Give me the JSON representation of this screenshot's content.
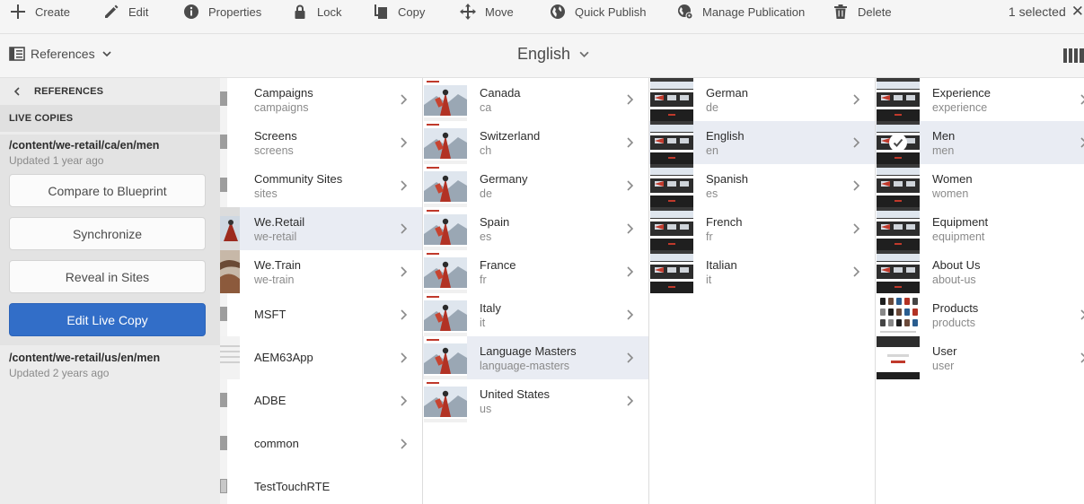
{
  "actionbar": {
    "actions": [
      {
        "label": "Create",
        "icon": "plus-icon"
      },
      {
        "label": "Edit",
        "icon": "pencil-icon"
      },
      {
        "label": "Properties",
        "icon": "info-icon"
      },
      {
        "label": "Lock",
        "icon": "lock-icon"
      },
      {
        "label": "Copy",
        "icon": "copy-icon"
      },
      {
        "label": "Move",
        "icon": "move-icon"
      },
      {
        "label": "Quick Publish",
        "icon": "globe-icon"
      },
      {
        "label": "Manage Publication",
        "icon": "globe-gear-icon"
      },
      {
        "label": "Delete",
        "icon": "trash-icon"
      }
    ],
    "selection_text": "1 selected"
  },
  "titlebar": {
    "rail_label": "References",
    "page_title": "English"
  },
  "rail": {
    "header": "REFERENCES",
    "section": "LIVE COPIES",
    "copies": [
      {
        "path": "/content/we-retail/ca/en/men",
        "updated": "Updated 1 year ago"
      },
      {
        "path": "/content/we-retail/us/en/men",
        "updated": "Updated 2 years ago"
      }
    ],
    "buttons": {
      "compare": "Compare to Blueprint",
      "sync": "Synchronize",
      "reveal": "Reveal in Sites",
      "edit": "Edit Live Copy"
    }
  },
  "columns": {
    "col1": [
      {
        "title": "Campaigns",
        "name": "campaigns"
      },
      {
        "title": "Screens",
        "name": "screens"
      },
      {
        "title": "Community Sites",
        "name": "sites"
      },
      {
        "title": "We.Retail",
        "name": "we-retail"
      },
      {
        "title": "We.Train",
        "name": "we-train"
      },
      {
        "title": "MSFT",
        "name": ""
      },
      {
        "title": "AEM63App",
        "name": ""
      },
      {
        "title": "ADBE",
        "name": ""
      },
      {
        "title": "common",
        "name": ""
      },
      {
        "title": "TestTouchRTE",
        "name": ""
      }
    ],
    "col2": [
      {
        "title": "Canada",
        "name": "ca"
      },
      {
        "title": "Switzerland",
        "name": "ch"
      },
      {
        "title": "Germany",
        "name": "de"
      },
      {
        "title": "Spain",
        "name": "es"
      },
      {
        "title": "France",
        "name": "fr"
      },
      {
        "title": "Italy",
        "name": "it"
      },
      {
        "title": "Language Masters",
        "name": "language-masters"
      },
      {
        "title": "United States",
        "name": "us"
      }
    ],
    "col3": [
      {
        "title": "German",
        "name": "de"
      },
      {
        "title": "English",
        "name": "en"
      },
      {
        "title": "Spanish",
        "name": "es"
      },
      {
        "title": "French",
        "name": "fr"
      },
      {
        "title": "Italian",
        "name": "it"
      }
    ],
    "col4": [
      {
        "title": "Experience",
        "name": "experience"
      },
      {
        "title": "Men",
        "name": "men"
      },
      {
        "title": "Women",
        "name": "women"
      },
      {
        "title": "Equipment",
        "name": "equipment"
      },
      {
        "title": "About Us",
        "name": "about-us"
      },
      {
        "title": "Products",
        "name": "products"
      },
      {
        "title": "User",
        "name": "user"
      }
    ]
  },
  "colors": {
    "accent": "#326ec8",
    "highlight": "#e9ecf3",
    "rail": "#ececec"
  }
}
